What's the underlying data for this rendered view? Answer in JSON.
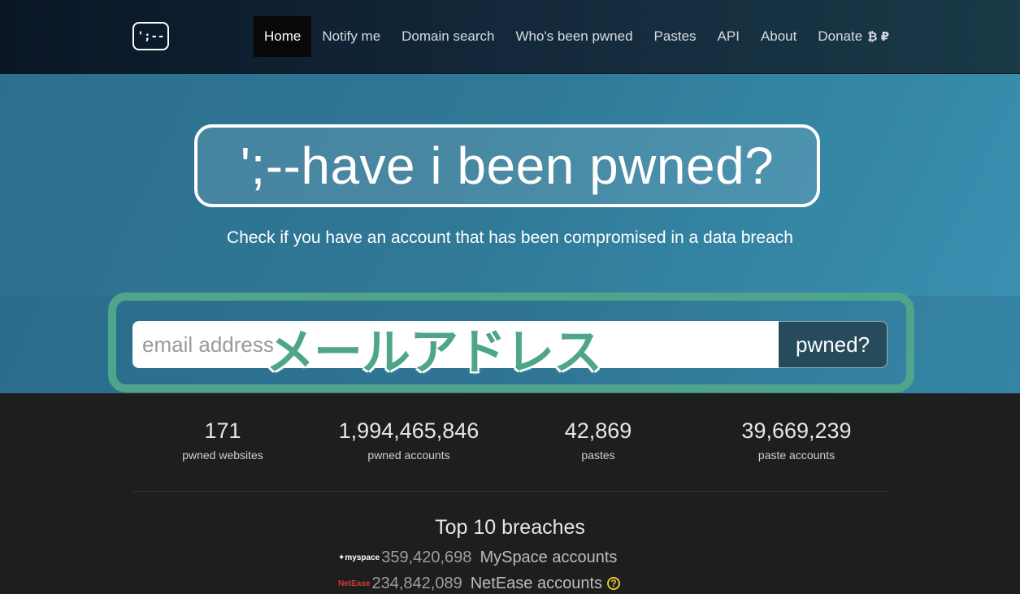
{
  "nav": {
    "logo_text": "';--",
    "items": [
      {
        "label": "Home",
        "active": true
      },
      {
        "label": "Notify me"
      },
      {
        "label": "Domain search"
      },
      {
        "label": "Who's been pwned"
      },
      {
        "label": "Pastes"
      },
      {
        "label": "API"
      },
      {
        "label": "About"
      },
      {
        "label": "Donate"
      }
    ],
    "donate_icons": "₿ ₽"
  },
  "hero": {
    "title": "';--have i been pwned?",
    "subtitle": "Check if you have an account that has been compromised in a data breach"
  },
  "search": {
    "placeholder": "email address",
    "button_label": "pwned?",
    "overlay_label": "メールアドレス",
    "highlight_color": "#4fa58c"
  },
  "stats": [
    {
      "value": "171",
      "label": "pwned websites"
    },
    {
      "value": "1,994,465,846",
      "label": "pwned accounts"
    },
    {
      "value": "42,869",
      "label": "pastes"
    },
    {
      "value": "39,669,239",
      "label": "paste accounts"
    }
  ],
  "top_breaches": {
    "title": "Top 10 breaches",
    "items": [
      {
        "logo": "myspace",
        "count": "359,420,698",
        "name": "MySpace accounts"
      },
      {
        "logo": "NetEase",
        "count": "234,842,089",
        "name": "NetEase accounts",
        "unverified": true
      }
    ]
  }
}
